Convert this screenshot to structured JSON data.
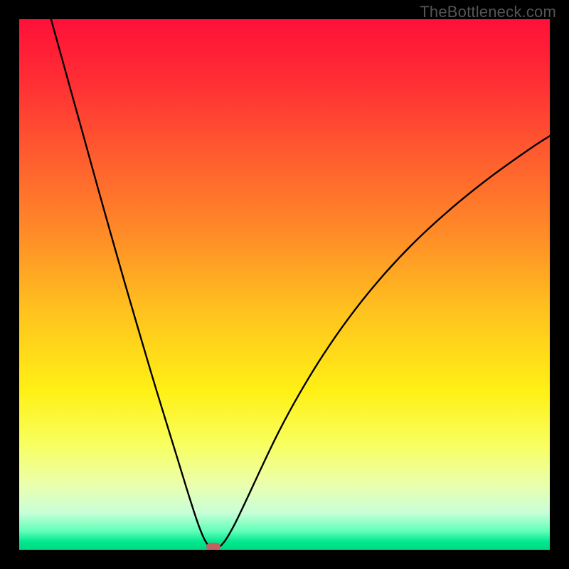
{
  "watermark": "TheBottleneck.com",
  "chart_data": {
    "type": "line",
    "title": "",
    "xlabel": "",
    "ylabel": "",
    "xlim": [
      0,
      1
    ],
    "ylim": [
      0,
      1
    ],
    "gradient_stops": [
      {
        "pos": 0.0,
        "color": "#ff1038"
      },
      {
        "pos": 0.12,
        "color": "#ff2f34"
      },
      {
        "pos": 0.25,
        "color": "#ff5a2f"
      },
      {
        "pos": 0.4,
        "color": "#ff8a28"
      },
      {
        "pos": 0.55,
        "color": "#ffc21e"
      },
      {
        "pos": 0.7,
        "color": "#fff015"
      },
      {
        "pos": 0.8,
        "color": "#f8ff5e"
      },
      {
        "pos": 0.88,
        "color": "#eaffb0"
      },
      {
        "pos": 0.93,
        "color": "#c8ffd8"
      },
      {
        "pos": 0.965,
        "color": "#60ffb8"
      },
      {
        "pos": 0.985,
        "color": "#00e890"
      },
      {
        "pos": 1.0,
        "color": "#00d880"
      }
    ],
    "series": [
      {
        "name": "bottleneck-curve",
        "points": [
          {
            "x": 0.06,
            "y": 1.0
          },
          {
            "x": 0.085,
            "y": 0.91
          },
          {
            "x": 0.11,
            "y": 0.82
          },
          {
            "x": 0.135,
            "y": 0.73
          },
          {
            "x": 0.16,
            "y": 0.64
          },
          {
            "x": 0.185,
            "y": 0.552
          },
          {
            "x": 0.21,
            "y": 0.465
          },
          {
            "x": 0.235,
            "y": 0.38
          },
          {
            "x": 0.26,
            "y": 0.296
          },
          {
            "x": 0.285,
            "y": 0.215
          },
          {
            "x": 0.305,
            "y": 0.15
          },
          {
            "x": 0.322,
            "y": 0.095
          },
          {
            "x": 0.336,
            "y": 0.052
          },
          {
            "x": 0.348,
            "y": 0.022
          },
          {
            "x": 0.358,
            "y": 0.006
          },
          {
            "x": 0.366,
            "y": 0.0
          },
          {
            "x": 0.376,
            "y": 0.004
          },
          {
            "x": 0.39,
            "y": 0.02
          },
          {
            "x": 0.408,
            "y": 0.052
          },
          {
            "x": 0.43,
            "y": 0.098
          },
          {
            "x": 0.458,
            "y": 0.158
          },
          {
            "x": 0.49,
            "y": 0.224
          },
          {
            "x": 0.528,
            "y": 0.294
          },
          {
            "x": 0.572,
            "y": 0.366
          },
          {
            "x": 0.622,
            "y": 0.438
          },
          {
            "x": 0.678,
            "y": 0.508
          },
          {
            "x": 0.74,
            "y": 0.575
          },
          {
            "x": 0.808,
            "y": 0.638
          },
          {
            "x": 0.882,
            "y": 0.698
          },
          {
            "x": 0.96,
            "y": 0.754
          },
          {
            "x": 1.0,
            "y": 0.78
          }
        ]
      }
    ],
    "marker": {
      "x": 0.366,
      "y": 0.0,
      "color": "#c56060"
    }
  }
}
